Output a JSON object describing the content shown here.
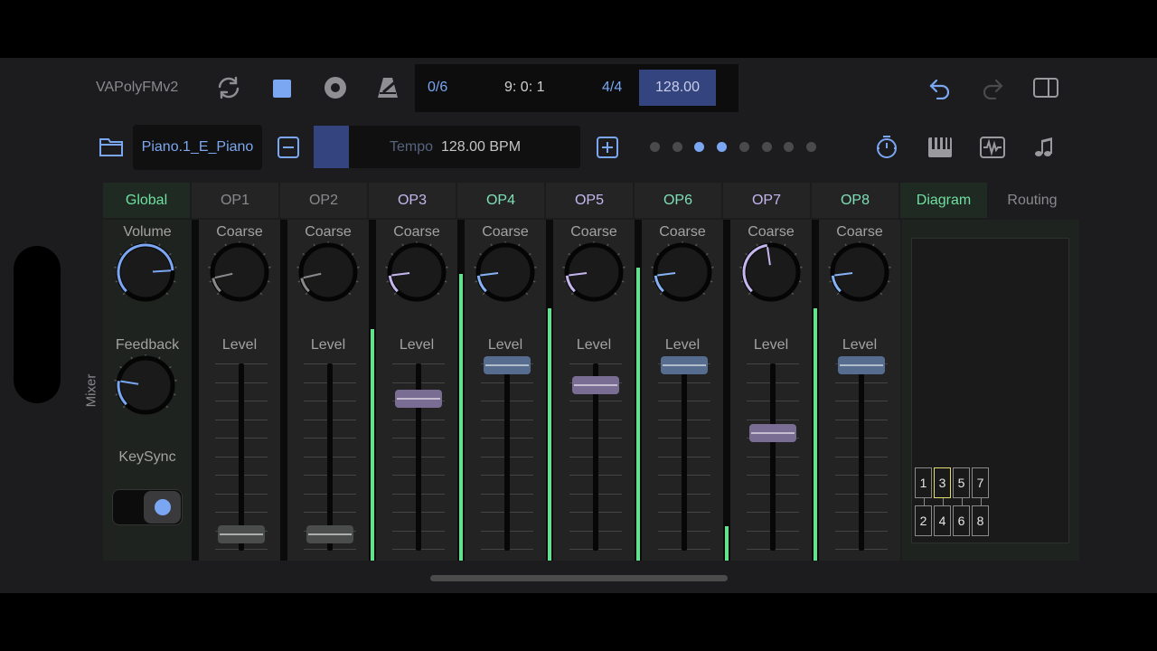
{
  "app": {
    "title": "VAPolyFMv2"
  },
  "transport": {
    "position": "0/6",
    "time": "9: 0: 1",
    "signature": "4/4",
    "tempo": "128.00"
  },
  "preset": {
    "name": "Piano.1_E_Piano",
    "tempo_label": "Tempo",
    "tempo_value": "128.00 BPM"
  },
  "page_dots": {
    "count": 8,
    "active": [
      2,
      3
    ]
  },
  "tabs": [
    {
      "label": "Global",
      "color": "#6fe0a0",
      "bg": "#1f2a22"
    },
    {
      "label": "OP1",
      "color": "#8a8a8e",
      "bg": "#232423"
    },
    {
      "label": "OP2",
      "color": "#8a8a8e",
      "bg": "#232423"
    },
    {
      "label": "OP3",
      "color": "#c6b6ef",
      "bg": "#232423"
    },
    {
      "label": "OP4",
      "color": "#7fe0b8",
      "bg": "#232423"
    },
    {
      "label": "OP5",
      "color": "#c6b6ef",
      "bg": "#232423"
    },
    {
      "label": "OP6",
      "color": "#7fe0b8",
      "bg": "#232423"
    },
    {
      "label": "OP7",
      "color": "#c6b6ef",
      "bg": "#232423"
    },
    {
      "label": "OP8",
      "color": "#7fe0b8",
      "bg": "#232423"
    },
    {
      "label": "Diagram",
      "color": "#6fe0a0",
      "bg": "#1f2a22"
    },
    {
      "label": "Routing",
      "color": "#8a8a8e",
      "bg": "#1c1c1e"
    }
  ],
  "mixer": {
    "label": "Mixer",
    "global": {
      "volume_label": "Volume",
      "volume": 0.82,
      "feedback_label": "Feedback",
      "feedback": 0.2,
      "keysync_label": "KeySync",
      "keysync_on": true
    },
    "operators": [
      {
        "name": "OP1",
        "coarse_label": "Coarse",
        "level_label": "Level",
        "coarse": 0.12,
        "level": 0.0,
        "meter": 0.0,
        "accent": "#8a8a8e"
      },
      {
        "name": "OP2",
        "coarse_label": "Coarse",
        "level_label": "Level",
        "coarse": 0.12,
        "level": 0.0,
        "meter": 0.0,
        "accent": "#8a8a8e"
      },
      {
        "name": "OP3",
        "coarse_label": "Coarse",
        "level_label": "Level",
        "coarse": 0.14,
        "level": 0.8,
        "meter": 0.68,
        "accent": "#c6b6ef"
      },
      {
        "name": "OP4",
        "coarse_label": "Coarse",
        "level_label": "Level",
        "coarse": 0.14,
        "level": 1.0,
        "meter": 0.84,
        "accent": "#86b3f5"
      },
      {
        "name": "OP5",
        "coarse_label": "Coarse",
        "level_label": "Level",
        "coarse": 0.14,
        "level": 0.88,
        "meter": 0.74,
        "accent": "#c6b6ef"
      },
      {
        "name": "OP6",
        "coarse_label": "Coarse",
        "level_label": "Level",
        "coarse": 0.14,
        "level": 1.0,
        "meter": 0.86,
        "accent": "#86b3f5"
      },
      {
        "name": "OP7",
        "coarse_label": "Coarse",
        "level_label": "Level",
        "coarse": 0.47,
        "level": 0.6,
        "meter": 0.1,
        "accent": "#c6b6ef"
      },
      {
        "name": "OP8",
        "coarse_label": "Coarse",
        "level_label": "Level",
        "coarse": 0.14,
        "level": 1.0,
        "meter": 0.74,
        "accent": "#86b3f5"
      }
    ]
  },
  "diagram": {
    "top_row": [
      "1",
      "3",
      "5",
      "7"
    ],
    "bottom_row": [
      "2",
      "4",
      "6",
      "8"
    ],
    "highlighted": "3"
  },
  "colors": {
    "meter": "#62e28f",
    "accent_blue": "#7aa6f2",
    "tempo_fill": "#34447f",
    "thumb_grey": "#4b4c4c",
    "thumb_purple": "#7a6d94",
    "thumb_blue": "#566d8f"
  },
  "icons": {
    "cycle": "cycle-icon",
    "stop": "stop-icon",
    "record": "record-icon",
    "metronome": "metronome-icon",
    "undo": "undo-icon",
    "redo": "redo-icon",
    "sidebar": "sidebar-icon",
    "folder": "folder-icon",
    "minus": "minus-icon",
    "plus": "plus-icon",
    "timer": "timer-icon",
    "keyboard": "keyboard-icon",
    "waveform": "waveform-icon",
    "notes": "notes-icon"
  }
}
